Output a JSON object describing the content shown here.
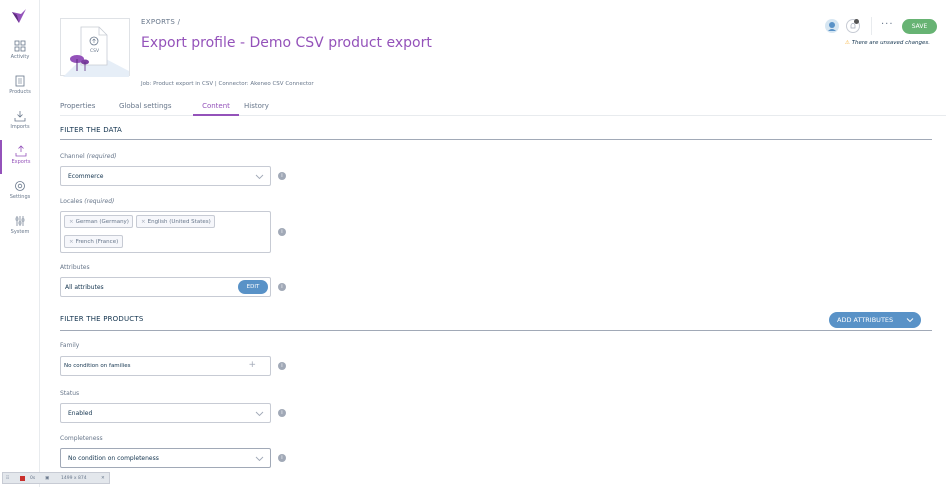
{
  "nav": {
    "items": [
      {
        "id": "activity",
        "label": "Activity",
        "icon": "grid-icon"
      },
      {
        "id": "products",
        "label": "Products",
        "icon": "document-icon"
      },
      {
        "id": "imports",
        "label": "Imports",
        "icon": "import-icon"
      },
      {
        "id": "exports",
        "label": "Exports",
        "icon": "export-icon",
        "active": true
      },
      {
        "id": "settings",
        "label": "Settings",
        "icon": "gear-icon"
      },
      {
        "id": "system",
        "label": "System",
        "icon": "sliders-icon"
      }
    ]
  },
  "header": {
    "breadcrumb": "EXPORTS /",
    "title": "Export profile - Demo CSV product export",
    "meta": "Job: Product export in CSV | Connector: Akeneo CSV Connector",
    "thumb_label": "CSV",
    "save_label": "SAVE",
    "more_label": "···",
    "unsaved_text": "There are unsaved changes."
  },
  "tabs": [
    {
      "label": "Properties",
      "active": false
    },
    {
      "label": "Global settings",
      "active": false
    },
    {
      "label": "Content",
      "active": true
    },
    {
      "label": "History",
      "active": false
    }
  ],
  "filter_data": {
    "title": "FILTER THE DATA",
    "channel": {
      "label": "Channel",
      "required": "(required)",
      "value": "Ecommerce"
    },
    "locales": {
      "label": "Locales",
      "required": "(required)",
      "chips": [
        "German (Germany)",
        "English (United States)",
        "French (France)"
      ]
    },
    "attributes": {
      "label": "Attributes",
      "value": "All attributes",
      "edit_label": "EDIT"
    }
  },
  "filter_products": {
    "title": "FILTER THE PRODUCTS",
    "add_attributes_label": "ADD ATTRIBUTES",
    "family": {
      "label": "Family",
      "value": "No condition on families",
      "add_symbol": "+"
    },
    "status": {
      "label": "Status",
      "value": "Enabled"
    },
    "completeness": {
      "label": "Completeness",
      "value": "No condition on completeness"
    }
  },
  "debugbar": {
    "zoom": "0s",
    "size": "1499 x 874",
    "close": "✕"
  },
  "colors": {
    "accent": "#9452ba",
    "save": "#67b373",
    "blue_button": "#5992c7",
    "text_dark": "#11324d",
    "text_grey": "#67768a"
  }
}
